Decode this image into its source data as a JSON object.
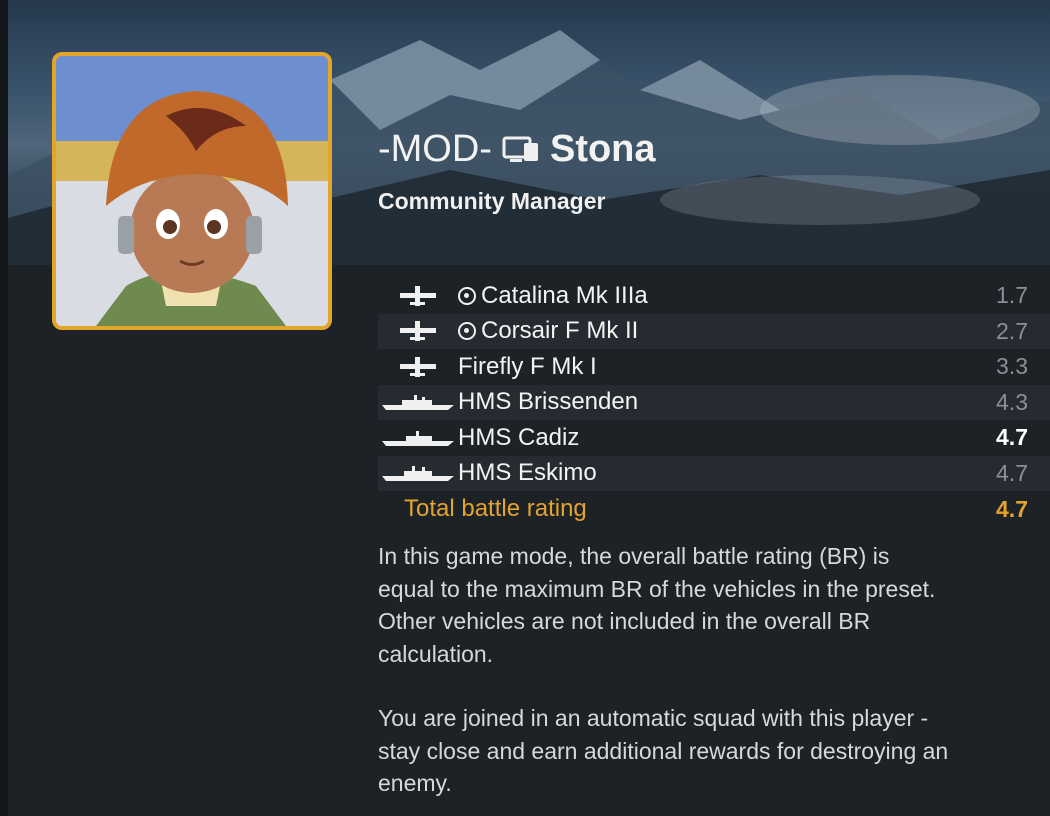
{
  "player": {
    "prefix": "-MOD-",
    "name": "Stona",
    "title": "Community Manager"
  },
  "vehicles": [
    {
      "name": "Catalina Mk IIIa",
      "premium": true,
      "type": "plane",
      "br": "1.7",
      "highlight": false
    },
    {
      "name": "Corsair F Mk II",
      "premium": true,
      "type": "plane",
      "br": "2.7",
      "highlight": false
    },
    {
      "name": "Firefly F Mk I",
      "premium": false,
      "type": "plane",
      "br": "3.3",
      "highlight": false
    },
    {
      "name": "HMS Brissenden",
      "premium": false,
      "type": "ship",
      "br": "4.3",
      "highlight": false
    },
    {
      "name": "HMS Cadiz",
      "premium": false,
      "type": "ship",
      "br": "4.7",
      "highlight": true
    },
    {
      "name": "HMS Eskimo",
      "premium": false,
      "type": "ship",
      "br": "4.7",
      "highlight": false
    }
  ],
  "total": {
    "label": "Total battle rating",
    "value": "4.7"
  },
  "description": {
    "paragraph1": "In this game mode, the overall battle rating (BR) is\nequal to the maximum BR of the vehicles in the preset.\nOther vehicles are not included in the overall BR\ncalculation.",
    "paragraph2": "You are joined in an automatic squad with this player -\nstay close and earn additional rewards for destroying an\nenemy."
  },
  "colors": {
    "accent": "#e4a22f",
    "frame": "#e5a42a",
    "background": "#1d2226"
  },
  "icons": {
    "platform": "pc-monitor-icon",
    "plane": "plane-icon",
    "ship": "ship-icon",
    "premium": "premium-target-icon"
  }
}
